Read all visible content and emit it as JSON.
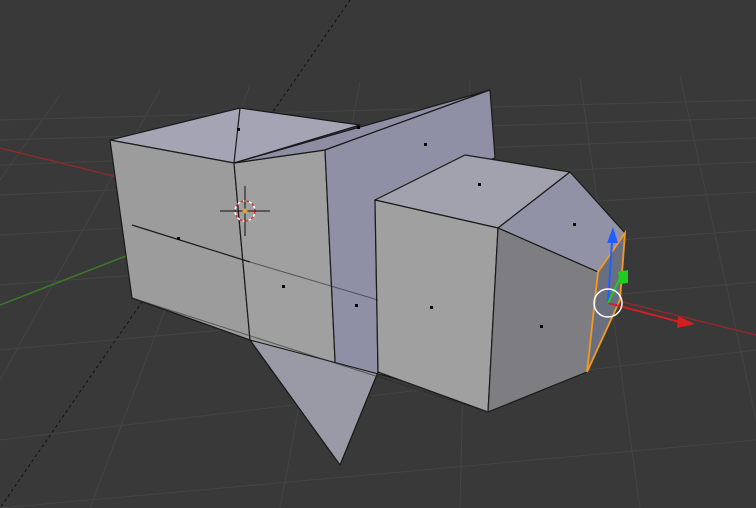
{
  "viewport": {
    "mode": "edit-mode-face-select",
    "background_color": "#393939",
    "grid_color": "#444444",
    "axis_x_color": "#8a2a2a",
    "axis_y_color": "#3a7a2a",
    "mesh_face_color": "#9a9aa0",
    "selected_face_color": "#6a6f80",
    "selection_outline_color": "#f39a1f",
    "gizmo_z_color": "#1f5fff",
    "gizmo_x_color": "#d21f1f",
    "gizmo_y_color": "#1fcc1f",
    "cursor_color": "#e03030"
  }
}
